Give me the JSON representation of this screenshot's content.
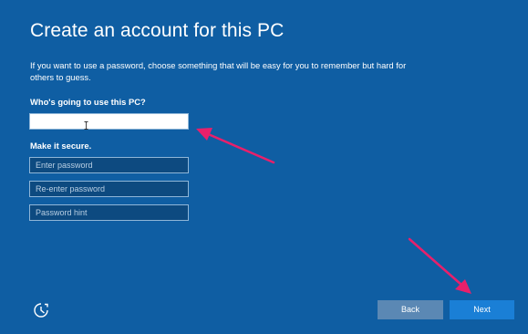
{
  "page": {
    "title": "Create an account for this PC",
    "intro": "If you want to use a password, choose something that will be easy for you to remember but hard for others to guess."
  },
  "form": {
    "username_label": "Who's going to use this PC?",
    "username_value": "",
    "secure_label": "Make it secure.",
    "password_placeholder": "Enter password",
    "reenter_placeholder": "Re-enter password",
    "hint_placeholder": "Password hint"
  },
  "footer": {
    "back_label": "Back",
    "next_label": "Next",
    "ease_of_access_icon": "ease-of-access-icon"
  },
  "colors": {
    "background": "#0f5ea3",
    "next_button": "#1a7fd6",
    "back_button": "#5b88b4",
    "annotation_arrow": "#e8206b"
  }
}
